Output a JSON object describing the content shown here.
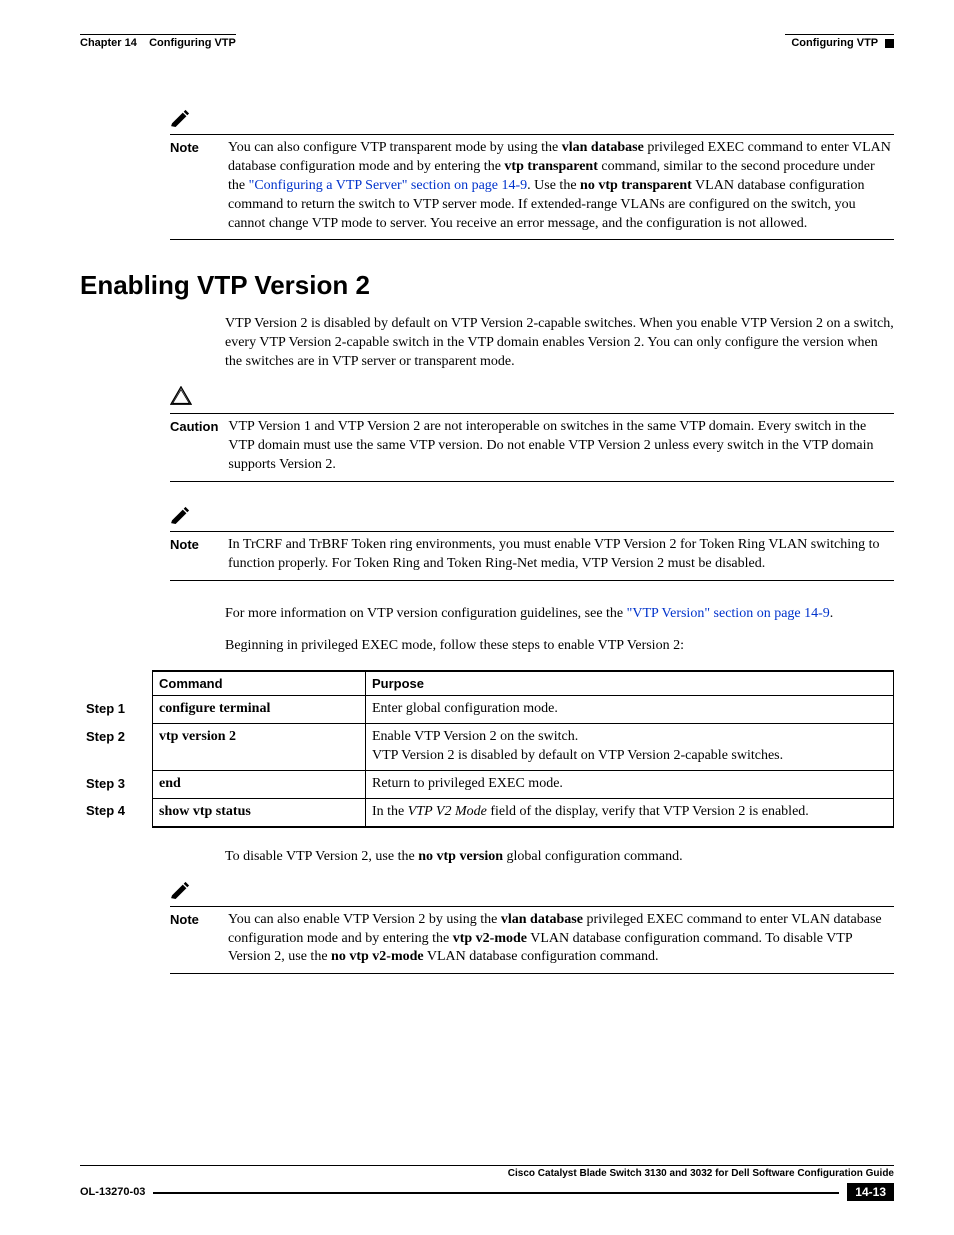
{
  "header": {
    "chapter_label": "Chapter 14",
    "chapter_title": "Configuring VTP",
    "section_right": "Configuring VTP"
  },
  "note1": {
    "label": "Note",
    "t1": "You can also configure VTP transparent mode by using the ",
    "b1": "vlan database",
    "t2": " privileged EXEC command to enter VLAN database configuration mode and by entering the ",
    "b2": "vtp transparent",
    "t3": " command, similar to the second procedure under the ",
    "link": "\"Configuring a VTP Server\" section on page 14-9",
    "t4": ". Use the ",
    "b3": "no vtp transparent",
    "t5": " VLAN database configuration command to return the switch to VTP server mode. If extended-range VLANs are configured on the switch, you cannot change VTP mode to server. You receive an error message, and the configuration is not allowed."
  },
  "section_heading": "Enabling VTP Version 2",
  "intro_para": "VTP Version 2 is disabled by default on VTP Version 2-capable switches. When you enable VTP Version 2 on a switch, every VTP Version 2-capable switch in the VTP domain enables Version 2. You can only configure the version when the switches are in VTP server or transparent mode.",
  "caution1": {
    "label": "Caution",
    "text": "VTP Version 1 and VTP Version 2 are not interoperable on switches in the same VTP domain. Every switch in the VTP domain must use the same VTP version. Do not enable VTP Version 2 unless every switch in the VTP domain supports Version 2."
  },
  "note2": {
    "label": "Note",
    "text": "In TrCRF and TrBRF Token ring environments, you must enable VTP Version 2 for Token Ring VLAN switching to function properly. For Token Ring and Token Ring-Net media, VTP Version 2 must be disabled."
  },
  "para_moreinfo": {
    "t1": "For more information on VTP version configuration guidelines, see the ",
    "link": "\"VTP Version\" section on page 14-9",
    "t2": "."
  },
  "para_begin": "Beginning in privileged EXEC mode, follow these steps to enable VTP Version 2:",
  "table": {
    "h_command": "Command",
    "h_purpose": "Purpose",
    "rows": [
      {
        "step": "Step 1",
        "cmd": "configure terminal",
        "purpose": "Enter global configuration mode."
      },
      {
        "step": "Step 2",
        "cmd": "vtp version 2",
        "purpose": "Enable VTP Version 2 on the switch.",
        "purpose2": "VTP Version 2 is disabled by default on VTP Version 2-capable switches."
      },
      {
        "step": "Step 3",
        "cmd": "end",
        "purpose": "Return to privileged EXEC mode."
      },
      {
        "step": "Step 4",
        "cmd": "show vtp status",
        "purpose_pre": "In the ",
        "purpose_italic": "VTP V2 Mode",
        "purpose_post": " field of the display, verify that VTP Version 2 is enabled."
      }
    ]
  },
  "para_disable": {
    "t1": "To disable VTP Version 2, use the ",
    "b1": "no vtp version",
    "t2": " global configuration command."
  },
  "note3": {
    "label": "Note",
    "t1": "You can also enable VTP Version 2 by using the ",
    "b1": "vlan database",
    "t2": " privileged EXEC command to enter VLAN database configuration mode and by entering the ",
    "b2": "vtp v2-mode",
    "t3": " VLAN database configuration command. To disable VTP Version 2, use the ",
    "b3": "no vtp v2-mode",
    "t4": " VLAN database configuration command."
  },
  "footer": {
    "guide": "Cisco Catalyst Blade Switch 3130 and 3032 for Dell Software Configuration Guide",
    "docnum": "OL-13270-03",
    "pagenum": "14-13"
  }
}
